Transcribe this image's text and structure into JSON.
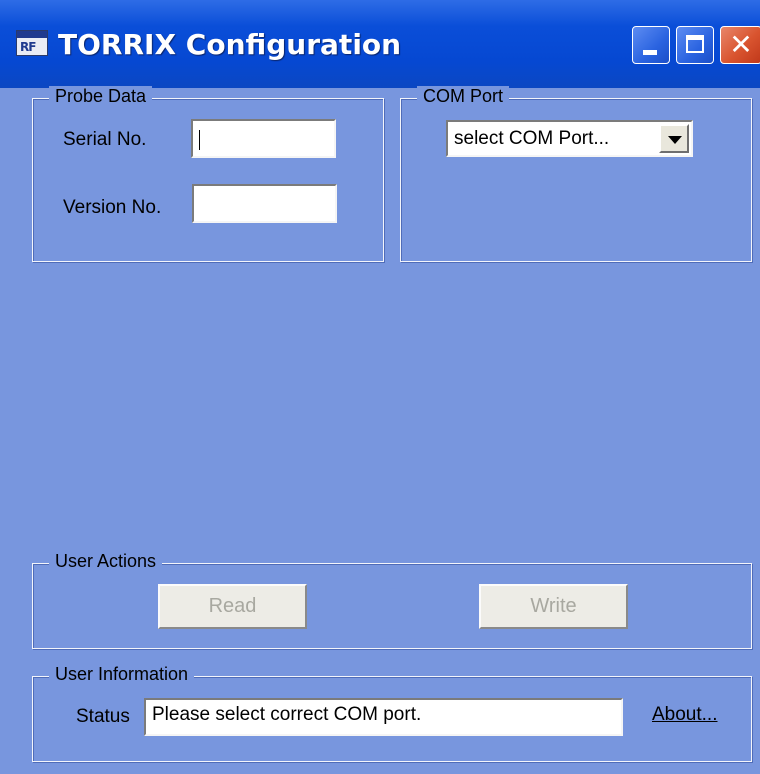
{
  "window": {
    "title": "TORRIX Configuration",
    "icon_glyph": "RF"
  },
  "probe_data": {
    "legend": "Probe Data",
    "serial_label": "Serial No.",
    "serial_value": "",
    "version_label": "Version No.",
    "version_value": ""
  },
  "com_port": {
    "legend": "COM Port",
    "selected": "select COM Port..."
  },
  "user_actions": {
    "legend": "User Actions",
    "read_label": "Read",
    "write_label": "Write"
  },
  "user_information": {
    "legend": "User Information",
    "status_label": "Status",
    "status_value": "Please select correct COM port.",
    "about_label": "About..."
  },
  "title_buttons": {
    "close_glyph": "✕"
  }
}
